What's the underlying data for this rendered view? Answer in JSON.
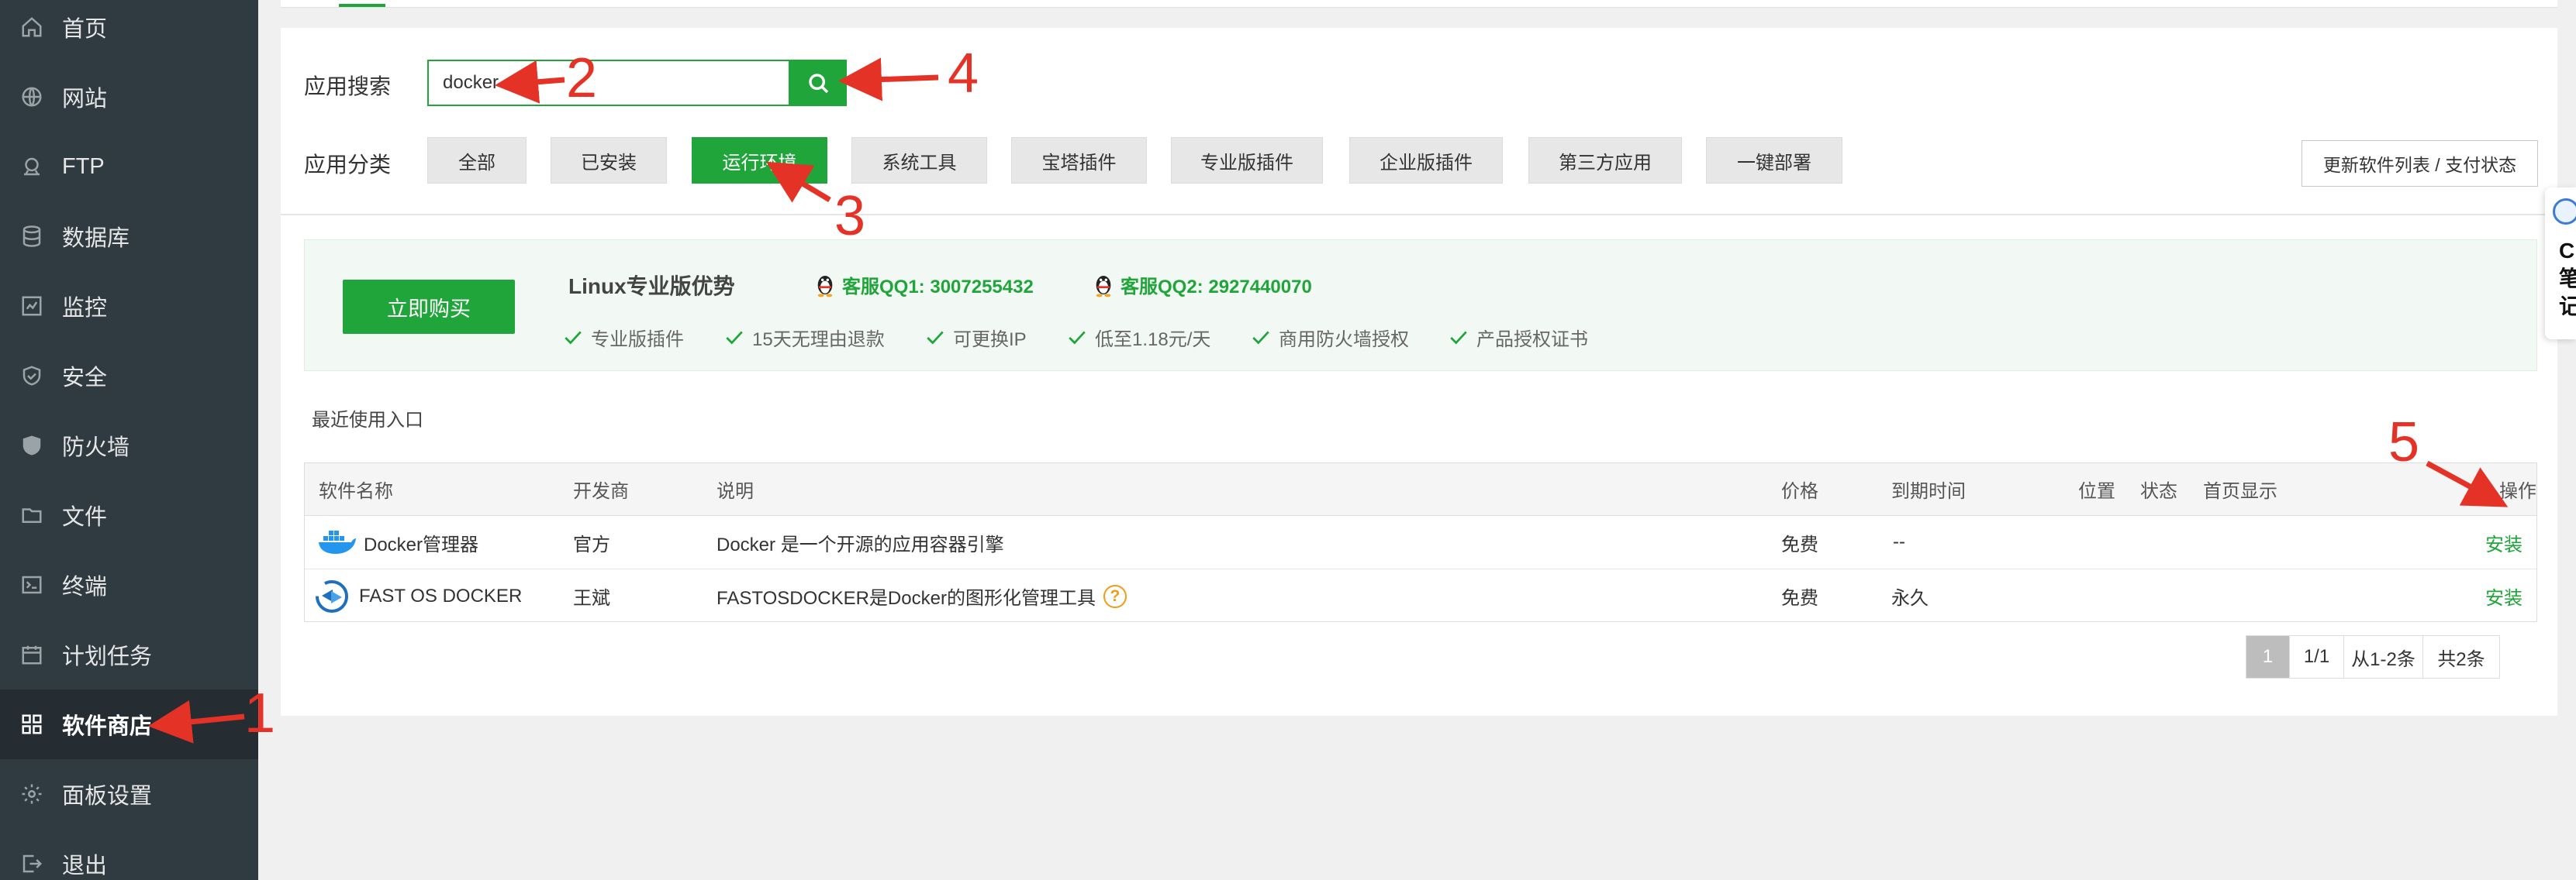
{
  "sidebar": {
    "items": [
      {
        "label": "首页",
        "icon": "home-icon"
      },
      {
        "label": "网站",
        "icon": "globe-icon"
      },
      {
        "label": "FTP",
        "icon": "ftp-icon"
      },
      {
        "label": "数据库",
        "icon": "database-icon"
      },
      {
        "label": "监控",
        "icon": "monitor-icon"
      },
      {
        "label": "安全",
        "icon": "shield-icon"
      },
      {
        "label": "防火墙",
        "icon": "firewall-icon"
      },
      {
        "label": "文件",
        "icon": "folder-icon"
      },
      {
        "label": "终端",
        "icon": "terminal-icon"
      },
      {
        "label": "计划任务",
        "icon": "calendar-icon"
      },
      {
        "label": "软件商店",
        "icon": "apps-grid-icon",
        "active": true
      },
      {
        "label": "面板设置",
        "icon": "gear-icon"
      },
      {
        "label": "退出",
        "icon": "logout-icon"
      }
    ]
  },
  "search": {
    "label": "应用搜索",
    "value": "docker"
  },
  "category": {
    "label": "应用分类",
    "items": [
      "全部",
      "已安装",
      "运行环境",
      "系统工具",
      "宝塔插件",
      "专业版插件",
      "企业版插件",
      "第三方应用",
      "一键部署"
    ],
    "active": "运行环境"
  },
  "update_button": "更新软件列表 / 支付状态",
  "promo": {
    "buy_button": "立即购买",
    "title": "Linux专业版优势",
    "qq1": "客服QQ1: 3007255432",
    "qq2": "客服QQ2: 2927440070",
    "features": [
      "专业版插件",
      "15天无理由退款",
      "可更换IP",
      "低至1.18元/天",
      "商用防火墙授权",
      "产品授权证书"
    ]
  },
  "recent_title": "最近使用入口",
  "table": {
    "headers": {
      "name": "软件名称",
      "developer": "开发商",
      "description": "说明",
      "price": "价格",
      "expire": "到期时间",
      "location": "位置",
      "status": "状态",
      "homepage": "首页显示",
      "action": "操作"
    },
    "rows": [
      {
        "name": "Docker管理器",
        "developer": "官方",
        "description": "Docker 是一个开源的应用容器引擎",
        "price": "免费",
        "expire": "--",
        "action": "安装"
      },
      {
        "name": "FAST OS DOCKER",
        "developer": "王斌",
        "description": "FASTOSDOCKER是Docker的图形化管理工具",
        "price": "免费",
        "expire": "永久",
        "action": "安装"
      }
    ]
  },
  "pagination": {
    "current": "1",
    "pages": "1/1",
    "range": "从1-2条",
    "total": "共2条"
  },
  "float_widget": {
    "text": "C笔记"
  },
  "annotations": [
    "1",
    "2",
    "3",
    "4",
    "5"
  ],
  "colors": {
    "accent": "#20a53a",
    "sidebar_bg": "#2f3a41",
    "annotation": "#e53227"
  }
}
